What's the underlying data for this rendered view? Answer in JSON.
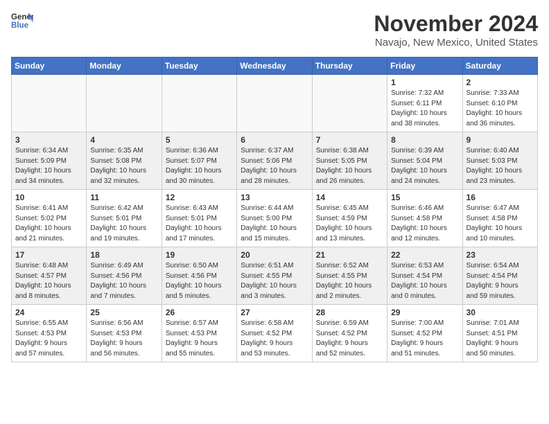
{
  "header": {
    "logo_line1": "General",
    "logo_line2": "Blue",
    "month": "November 2024",
    "location": "Navajo, New Mexico, United States"
  },
  "days_of_week": [
    "Sunday",
    "Monday",
    "Tuesday",
    "Wednesday",
    "Thursday",
    "Friday",
    "Saturday"
  ],
  "weeks": [
    [
      {
        "day": "",
        "info": ""
      },
      {
        "day": "",
        "info": ""
      },
      {
        "day": "",
        "info": ""
      },
      {
        "day": "",
        "info": ""
      },
      {
        "day": "",
        "info": ""
      },
      {
        "day": "1",
        "info": "Sunrise: 7:32 AM\nSunset: 6:11 PM\nDaylight: 10 hours\nand 38 minutes."
      },
      {
        "day": "2",
        "info": "Sunrise: 7:33 AM\nSunset: 6:10 PM\nDaylight: 10 hours\nand 36 minutes."
      }
    ],
    [
      {
        "day": "3",
        "info": "Sunrise: 6:34 AM\nSunset: 5:09 PM\nDaylight: 10 hours\nand 34 minutes."
      },
      {
        "day": "4",
        "info": "Sunrise: 6:35 AM\nSunset: 5:08 PM\nDaylight: 10 hours\nand 32 minutes."
      },
      {
        "day": "5",
        "info": "Sunrise: 6:36 AM\nSunset: 5:07 PM\nDaylight: 10 hours\nand 30 minutes."
      },
      {
        "day": "6",
        "info": "Sunrise: 6:37 AM\nSunset: 5:06 PM\nDaylight: 10 hours\nand 28 minutes."
      },
      {
        "day": "7",
        "info": "Sunrise: 6:38 AM\nSunset: 5:05 PM\nDaylight: 10 hours\nand 26 minutes."
      },
      {
        "day": "8",
        "info": "Sunrise: 6:39 AM\nSunset: 5:04 PM\nDaylight: 10 hours\nand 24 minutes."
      },
      {
        "day": "9",
        "info": "Sunrise: 6:40 AM\nSunset: 5:03 PM\nDaylight: 10 hours\nand 23 minutes."
      }
    ],
    [
      {
        "day": "10",
        "info": "Sunrise: 6:41 AM\nSunset: 5:02 PM\nDaylight: 10 hours\nand 21 minutes."
      },
      {
        "day": "11",
        "info": "Sunrise: 6:42 AM\nSunset: 5:01 PM\nDaylight: 10 hours\nand 19 minutes."
      },
      {
        "day": "12",
        "info": "Sunrise: 6:43 AM\nSunset: 5:01 PM\nDaylight: 10 hours\nand 17 minutes."
      },
      {
        "day": "13",
        "info": "Sunrise: 6:44 AM\nSunset: 5:00 PM\nDaylight: 10 hours\nand 15 minutes."
      },
      {
        "day": "14",
        "info": "Sunrise: 6:45 AM\nSunset: 4:59 PM\nDaylight: 10 hours\nand 13 minutes."
      },
      {
        "day": "15",
        "info": "Sunrise: 6:46 AM\nSunset: 4:58 PM\nDaylight: 10 hours\nand 12 minutes."
      },
      {
        "day": "16",
        "info": "Sunrise: 6:47 AM\nSunset: 4:58 PM\nDaylight: 10 hours\nand 10 minutes."
      }
    ],
    [
      {
        "day": "17",
        "info": "Sunrise: 6:48 AM\nSunset: 4:57 PM\nDaylight: 10 hours\nand 8 minutes."
      },
      {
        "day": "18",
        "info": "Sunrise: 6:49 AM\nSunset: 4:56 PM\nDaylight: 10 hours\nand 7 minutes."
      },
      {
        "day": "19",
        "info": "Sunrise: 6:50 AM\nSunset: 4:56 PM\nDaylight: 10 hours\nand 5 minutes."
      },
      {
        "day": "20",
        "info": "Sunrise: 6:51 AM\nSunset: 4:55 PM\nDaylight: 10 hours\nand 3 minutes."
      },
      {
        "day": "21",
        "info": "Sunrise: 6:52 AM\nSunset: 4:55 PM\nDaylight: 10 hours\nand 2 minutes."
      },
      {
        "day": "22",
        "info": "Sunrise: 6:53 AM\nSunset: 4:54 PM\nDaylight: 10 hours\nand 0 minutes."
      },
      {
        "day": "23",
        "info": "Sunrise: 6:54 AM\nSunset: 4:54 PM\nDaylight: 9 hours\nand 59 minutes."
      }
    ],
    [
      {
        "day": "24",
        "info": "Sunrise: 6:55 AM\nSunset: 4:53 PM\nDaylight: 9 hours\nand 57 minutes."
      },
      {
        "day": "25",
        "info": "Sunrise: 6:56 AM\nSunset: 4:53 PM\nDaylight: 9 hours\nand 56 minutes."
      },
      {
        "day": "26",
        "info": "Sunrise: 6:57 AM\nSunset: 4:53 PM\nDaylight: 9 hours\nand 55 minutes."
      },
      {
        "day": "27",
        "info": "Sunrise: 6:58 AM\nSunset: 4:52 PM\nDaylight: 9 hours\nand 53 minutes."
      },
      {
        "day": "28",
        "info": "Sunrise: 6:59 AM\nSunset: 4:52 PM\nDaylight: 9 hours\nand 52 minutes."
      },
      {
        "day": "29",
        "info": "Sunrise: 7:00 AM\nSunset: 4:52 PM\nDaylight: 9 hours\nand 51 minutes."
      },
      {
        "day": "30",
        "info": "Sunrise: 7:01 AM\nSunset: 4:51 PM\nDaylight: 9 hours\nand 50 minutes."
      }
    ]
  ]
}
